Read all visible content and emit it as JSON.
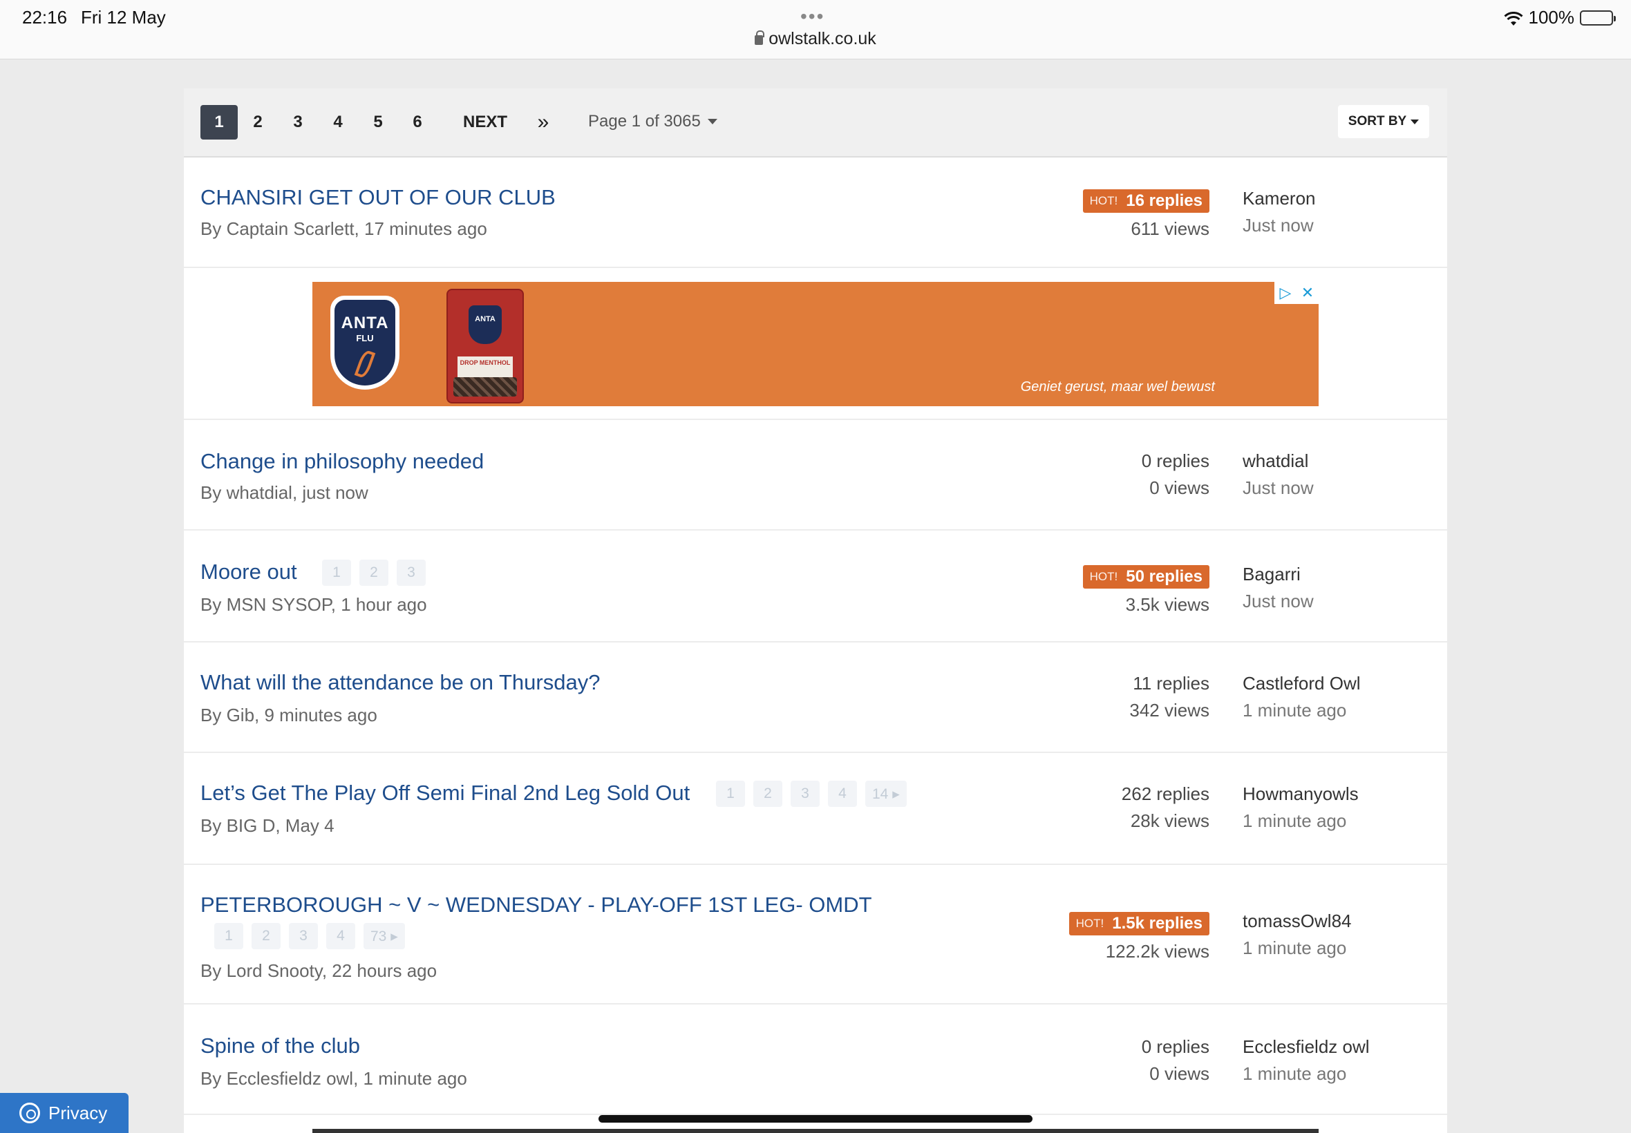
{
  "status_bar": {
    "time": "22:16",
    "date": "Fri 12 May",
    "dots": "•••",
    "url": "owlstalk.co.uk",
    "battery": "100%"
  },
  "pagination": {
    "pages": [
      "1",
      "2",
      "3",
      "4",
      "5",
      "6"
    ],
    "active_page": "1",
    "next_label": "NEXT",
    "last_label": "»",
    "page_info": "Page 1 of 3065",
    "sort_label": "SORT BY"
  },
  "hot_label": "HOT!",
  "topics": [
    {
      "title": "CHANSIRI GET OUT OF OUR CLUB",
      "byline": "By Captain Scarlett, 17 minutes ago",
      "hot": true,
      "replies": "16 replies",
      "views": "611 views",
      "last_user": "Kameron",
      "last_time": "Just now",
      "pages": []
    },
    {
      "title": "Change in philosophy needed",
      "byline": "By whatdial, just now",
      "hot": false,
      "replies": "0 replies",
      "views": "0 views",
      "last_user": "whatdial",
      "last_time": "Just now",
      "pages": []
    },
    {
      "title": "Moore out",
      "byline": "By MSN SYSOP, 1 hour ago",
      "hot": true,
      "replies": "50 replies",
      "views": "3.5k views",
      "last_user": "Bagarri",
      "last_time": "Just now",
      "pages": [
        "1",
        "2",
        "3"
      ]
    },
    {
      "title": "What will the attendance be on Thursday?",
      "byline": "By Gib, 9 minutes ago",
      "hot": false,
      "replies": "11 replies",
      "views": "342 views",
      "last_user": "Castleford Owl",
      "last_time": "1 minute ago",
      "pages": []
    },
    {
      "title": "Let’s Get The Play Off Semi Final 2nd Leg Sold Out",
      "byline": "By BIG D, May 4",
      "hot": false,
      "replies": "262 replies",
      "views": "28k views",
      "last_user": "Howmanyowls",
      "last_time": "1 minute ago",
      "pages": [
        "1",
        "2",
        "3",
        "4",
        "14 ▸"
      ]
    },
    {
      "title": "PETERBOROUGH ~ V ~ WEDNESDAY - PLAY-OFF 1ST LEG- OMDT",
      "byline": "By Lord Snooty, 22 hours ago",
      "hot": true,
      "replies": "1.5k replies",
      "views": "122.2k views",
      "last_user": "tomassOwl84",
      "last_time": "1 minute ago",
      "pages": [
        "1",
        "2",
        "3",
        "4",
        "73 ▸"
      ]
    },
    {
      "title": "Spine of the club",
      "byline": "By Ecclesfieldz owl, 1 minute ago",
      "hot": false,
      "replies": "0 replies",
      "views": "0 views",
      "last_user": "Ecclesfieldz owl",
      "last_time": "1 minute ago",
      "pages": []
    }
  ],
  "ad": {
    "brand": "ANTA",
    "brand_sub": "FLU",
    "pack_label": "DROP MENTHOL",
    "tagline": "Geniet gerust, maar wel bewust",
    "adchoices": "▷",
    "close": "✕"
  },
  "privacy_label": "Privacy"
}
